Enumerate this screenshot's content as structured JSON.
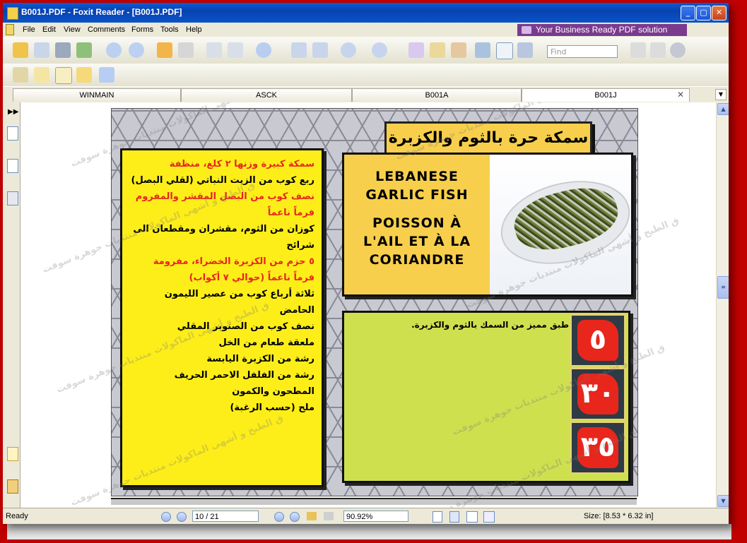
{
  "window": {
    "title": "B001J.PDF - Foxit Reader - [B001J.PDF]",
    "controls": [
      "minimize",
      "maximize",
      "close"
    ]
  },
  "menu": {
    "items": [
      "File",
      "Edit",
      "View",
      "Comments",
      "Forms",
      "Tools",
      "Help"
    ],
    "promo": "Your Business Ready PDF solution"
  },
  "toolbar": {
    "find_placeholder": "Find"
  },
  "tabs": [
    {
      "label": "WINMAIN",
      "active": false
    },
    {
      "label": "ASCK",
      "active": false
    },
    {
      "label": "B001A",
      "active": false
    },
    {
      "label": "B001J",
      "active": true
    }
  ],
  "document": {
    "arabic_title": "سمكة حرة بالثوم والكزبرة",
    "english_title": "LEBANESE GARLIC FISH",
    "french_title": "POISSON À L'AIL ET À LA CORIANDRE",
    "description": "طبق مميز من السمك بالثوم والكزبرة.",
    "ingredients": [
      {
        "text": "سمكة كبيرة وزنها ٢ كلغ، منظفة",
        "color": "red"
      },
      {
        "text": "ربع كوب من الزيت النباتي (لقلي البصل)",
        "color": "black"
      },
      {
        "text": "نصف كوب من البصل المقشر والمفروم فرماً ناعماً",
        "color": "red"
      },
      {
        "text": "كوزان من الثوم، مقشران ومقطعان الى شرائح",
        "color": "black"
      },
      {
        "text": "٥ حزم من الكزبرة الخضراء، مفرومة فرماً ناعماً (حوالي ٧ أكواب)",
        "color": "red"
      },
      {
        "text": "ثلاثة أرباع كوب من عصير الليمون الحامض",
        "color": "black"
      },
      {
        "text": "نصف كوب من الصنوبر المقلي",
        "color": "black"
      },
      {
        "text": "ملعقة طعام من الخل",
        "color": "black"
      },
      {
        "text": "رشة من الكزبرة اليابسة",
        "color": "black"
      },
      {
        "text": "رشة من الفلفل الاحمر الحريف المطحون والكمون",
        "color": "black"
      },
      {
        "text": "ملح (حسب الرغبة)",
        "color": "black"
      }
    ],
    "numbers": [
      "٥",
      "٣٠",
      "٣٥"
    ],
    "watermark": "ق الطبخ و أشهى الماكولات منتديات جوهرة سوفت"
  },
  "status": {
    "ready": "Ready",
    "page": "10 / 21",
    "zoom": "90.92%",
    "size": "Size: [8.53 * 6.32 in]"
  },
  "colors": {
    "yellow": "#fdee1a",
    "orange_yellow": "#f7cf4c",
    "green": "#cfe04f",
    "red": "#e8261c",
    "frame": "#c10000"
  }
}
